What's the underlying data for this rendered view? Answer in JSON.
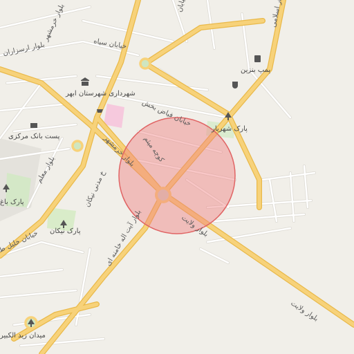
{
  "map": {
    "colors": {
      "background": "#f1efe9",
      "major_road": "#f7d27a",
      "major_road_casing": "#e9b94a",
      "minor_road": "#ffffff",
      "minor_road_casing": "#dcd9d2",
      "park": "#d4e8c7",
      "pink_area": "#f6c9dd",
      "circle_fill": "#f08080",
      "circle_stroke": "#e06464"
    },
    "road_labels": {
      "blvd_velayat_1": "بلوار ولایت",
      "blvd_velayat_2": "بلوار ولایت",
      "blvd_ayatollah_khamenei": "بلوار آیت اله خامنه ای",
      "blvd_khorramshahr_1": "بلوار خرمشهر",
      "blvd_khorramshahr_2": "بلوار خرمشهر",
      "st_fayyaz_bakhsh": "خیابان فیاض بخش",
      "st_siah": "خیابان سیاه",
      "blvd_arsaran": "بلوار ارسزاران",
      "blvd_moallem": "بلوار معلم",
      "st_madani": "خ مدنی نیکان",
      "st_khalil": "خیابان خلیل ط",
      "blvd_islami": "بلوار اسلامی",
      "kooche_miyam": "کوچه میثم",
      "top_st": "خیابان"
    },
    "poi_labels": {
      "gas_station": "پمپ بنزین",
      "municipality": "شهرداری شهرستان ابهر",
      "central_post": "پست بانک مرکزی",
      "park_shahriar": "پارک شهریار",
      "park_nikan": "پارک نیکان",
      "park_bagh": "پارک باغ",
      "zeid_square": "میدان زید الکبیر"
    },
    "icons": {
      "gas": "fuel-pump-icon",
      "cafe": "cafe-icon",
      "museum": "landmark-icon",
      "shop": "cart-icon",
      "post": "mail-icon",
      "tree": "tree-icon"
    }
  }
}
